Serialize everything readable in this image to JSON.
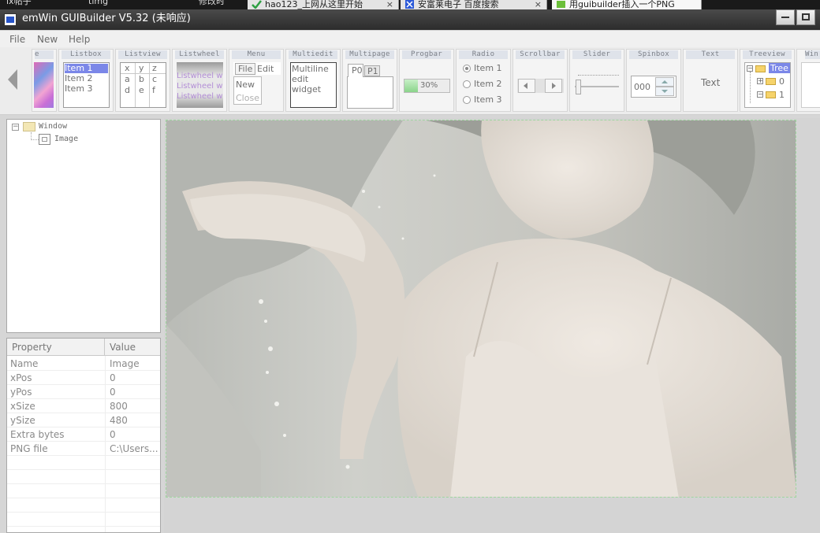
{
  "taskbar": {
    "left_text_1": "lx帖子",
    "left_text_2": "timg",
    "left_text_3": "修改时",
    "tabs": [
      {
        "label": "hao123_上网从这里开始"
      },
      {
        "label": "安富莱电子 百度搜索"
      },
      {
        "label": "用guibuilder插入一个PNG"
      }
    ]
  },
  "window": {
    "title": "emWin GUIBuilder V5.32 (未响应)"
  },
  "menu": {
    "items": [
      "File",
      "New",
      "Help"
    ]
  },
  "palette": {
    "image": {
      "title": "e"
    },
    "listbox": {
      "title": "Listbox",
      "items": [
        "Item 1",
        "Item 2",
        "Item 3"
      ]
    },
    "listview": {
      "title": "Listview",
      "header": [
        "x",
        "y",
        "z"
      ],
      "row": [
        "a",
        "b",
        "c"
      ],
      "row2": [
        "d",
        "e",
        "f"
      ]
    },
    "listwheel": {
      "title": "Listwheel",
      "items": [
        "Listwheel wi",
        "Listwheel wi",
        "Listwheel wi"
      ]
    },
    "menu": {
      "title": "Menu",
      "items": [
        "File",
        "Edit"
      ],
      "sub": [
        "New",
        "Close"
      ]
    },
    "multiedit": {
      "title": "Multiedit",
      "lines": [
        "Multiline",
        "edit",
        "widget"
      ]
    },
    "multipage": {
      "title": "Multipage",
      "tabs": [
        "P0",
        "P1"
      ]
    },
    "progbar": {
      "title": "Progbar",
      "label": "30%",
      "value": 0.3
    },
    "radio": {
      "title": "Radio",
      "items": [
        "Item 1",
        "Item 2",
        "Item 3"
      ]
    },
    "scrollbar": {
      "title": "Scrollbar"
    },
    "slider": {
      "title": "Slider"
    },
    "spinbox": {
      "title": "Spinbox",
      "value": "000"
    },
    "text": {
      "title": "Text",
      "label": "Text"
    },
    "treeview": {
      "title": "Treeview",
      "root": "Tree",
      "n1": "0",
      "n2": "1"
    },
    "window": {
      "title": "Win"
    }
  },
  "tree": {
    "root": "Window",
    "child": "Image"
  },
  "properties": {
    "headers": [
      "Property",
      "Value"
    ],
    "rows": [
      {
        "k": "Name",
        "v": "Image"
      },
      {
        "k": "xPos",
        "v": "0"
      },
      {
        "k": "yPos",
        "v": "0"
      },
      {
        "k": "xSize",
        "v": "800"
      },
      {
        "k": "ySize",
        "v": "480"
      },
      {
        "k": "Extra bytes",
        "v": "0"
      },
      {
        "k": "PNG file",
        "v": "C:\\Users..."
      }
    ]
  },
  "colors": {
    "accent": "#2855c8",
    "selection": "#7b87e8",
    "image_border": "#9fd69f",
    "titlebar": "#3a3a3a"
  }
}
